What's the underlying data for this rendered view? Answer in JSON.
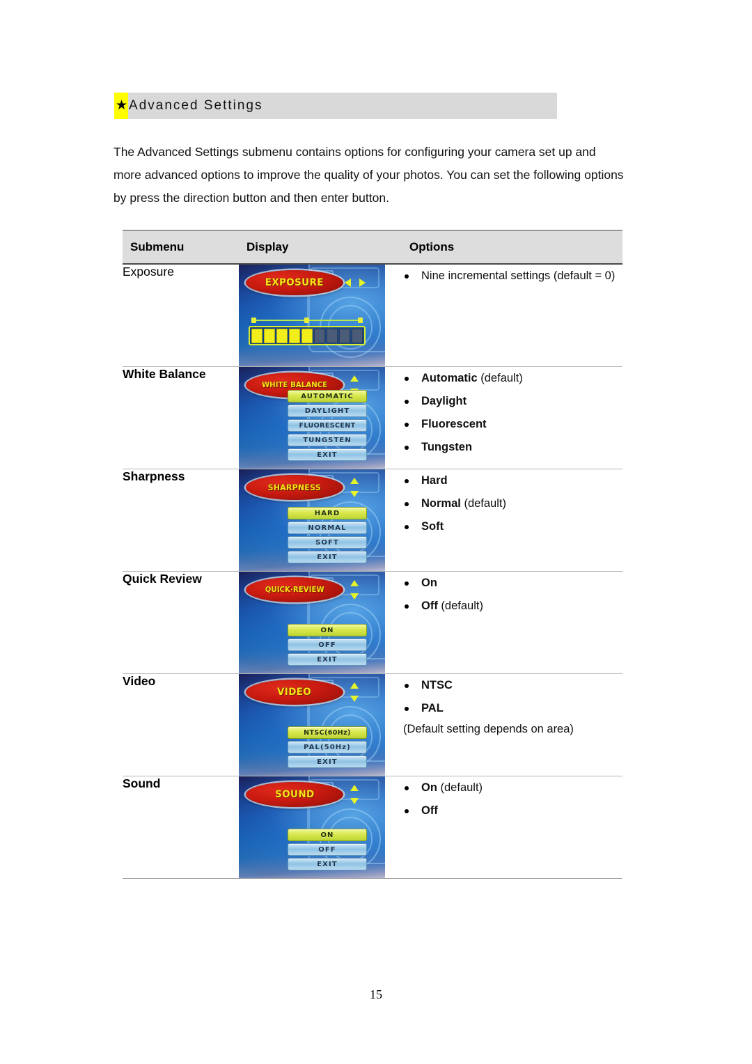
{
  "section": {
    "star_glyph": "★",
    "title": "Advanced Settings"
  },
  "intro": {
    "line1": "The Advanced Settings submenu contains options for configuring your camera set up and",
    "line2": "more advanced options to improve the quality of your photos. You can set the following options",
    "line3": "by press the direction button and then enter button."
  },
  "table": {
    "headers": {
      "submenu": "Submenu",
      "display": "Display",
      "options": "Options"
    },
    "rows": [
      {
        "submenu": "Exposure",
        "submenu_bold": false,
        "display": {
          "kind": "exposure",
          "title": "EXPOSURE",
          "title_size": "normal",
          "arrows": "left-right",
          "segments_total": 9,
          "segments_on": 5
        },
        "options": [
          {
            "label": "Nine incremental settings (default = 0)",
            "bold": false,
            "suffix": ""
          }
        ],
        "note": ""
      },
      {
        "submenu": "White Balance",
        "submenu_bold": true,
        "display": {
          "kind": "menu",
          "title": "WHITE BALANCE",
          "title_size": "xsmall",
          "arrows": "up-down",
          "buttons": [
            {
              "label": "AUTOMATIC",
              "selected": true
            },
            {
              "label": "DAYLIGHT",
              "selected": false
            },
            {
              "label": "FLUORESCENT",
              "selected": false
            },
            {
              "label": "TUNGSTEN",
              "selected": false
            },
            {
              "label": "EXIT",
              "selected": false
            }
          ]
        },
        "options": [
          {
            "label": "Automatic",
            "bold": true,
            "suffix": " (default)"
          },
          {
            "label": "Daylight",
            "bold": true,
            "suffix": ""
          },
          {
            "label": "Fluorescent",
            "bold": true,
            "suffix": ""
          },
          {
            "label": "Tungsten",
            "bold": true,
            "suffix": ""
          }
        ],
        "note": ""
      },
      {
        "submenu": "Sharpness",
        "submenu_bold": true,
        "display": {
          "kind": "menu",
          "title": "SHARPNESS",
          "title_size": "small",
          "arrows": "up-down",
          "buttons": [
            {
              "label": "HARD",
              "selected": true
            },
            {
              "label": "NORMAL",
              "selected": false
            },
            {
              "label": "SOFT",
              "selected": false
            },
            {
              "label": "EXIT",
              "selected": false
            }
          ]
        },
        "options": [
          {
            "label": "Hard",
            "bold": true,
            "suffix": ""
          },
          {
            "label": "Normal",
            "bold": true,
            "suffix": " (default)"
          },
          {
            "label": "Soft",
            "bold": true,
            "suffix": ""
          }
        ],
        "note": ""
      },
      {
        "submenu": "Quick Review",
        "submenu_bold": true,
        "display": {
          "kind": "menu",
          "title": "QUICK·REVIEW",
          "title_size": "xsmall",
          "arrows": "up-down",
          "buttons": [
            {
              "label": "ON",
              "selected": true
            },
            {
              "label": "OFF",
              "selected": false
            },
            {
              "label": "EXIT",
              "selected": false
            }
          ]
        },
        "options": [
          {
            "label": "On",
            "bold": true,
            "suffix": ""
          },
          {
            "label": "Off",
            "bold": true,
            "suffix": " (default)"
          }
        ],
        "note": ""
      },
      {
        "submenu": "Video",
        "submenu_bold": true,
        "display": {
          "kind": "menu",
          "title": "VIDEO",
          "title_size": "normal",
          "arrows": "up-down",
          "buttons": [
            {
              "label": "NTSC(60Hz)",
              "selected": true
            },
            {
              "label": "PAL(50Hz)",
              "selected": false
            },
            {
              "label": "EXIT",
              "selected": false
            }
          ]
        },
        "options": [
          {
            "label": "NTSC",
            "bold": true,
            "suffix": ""
          },
          {
            "label": "PAL",
            "bold": true,
            "suffix": ""
          }
        ],
        "note": "(Default setting depends on area)"
      },
      {
        "submenu": "Sound",
        "submenu_bold": true,
        "display": {
          "kind": "menu",
          "title": "SOUND",
          "title_size": "normal",
          "arrows": "up-down",
          "buttons": [
            {
              "label": "ON",
              "selected": true
            },
            {
              "label": "OFF",
              "selected": false
            },
            {
              "label": "EXIT",
              "selected": false
            }
          ]
        },
        "options": [
          {
            "label": "On",
            "bold": true,
            "suffix": " (default)"
          },
          {
            "label": "Off",
            "bold": true,
            "suffix": ""
          }
        ],
        "note": ""
      }
    ]
  },
  "footer": {
    "page_number": "15"
  },
  "colors": {
    "band_gray": "#d9d9d9",
    "highlight_yellow": "#ffff00",
    "table_header_gray": "#dddddd",
    "lcd_title_red": "#c81a10",
    "lcd_title_text": "#ffe11a",
    "lcd_selected_green": "#d7e64a",
    "lcd_button_blue": "#8ec2e4"
  }
}
